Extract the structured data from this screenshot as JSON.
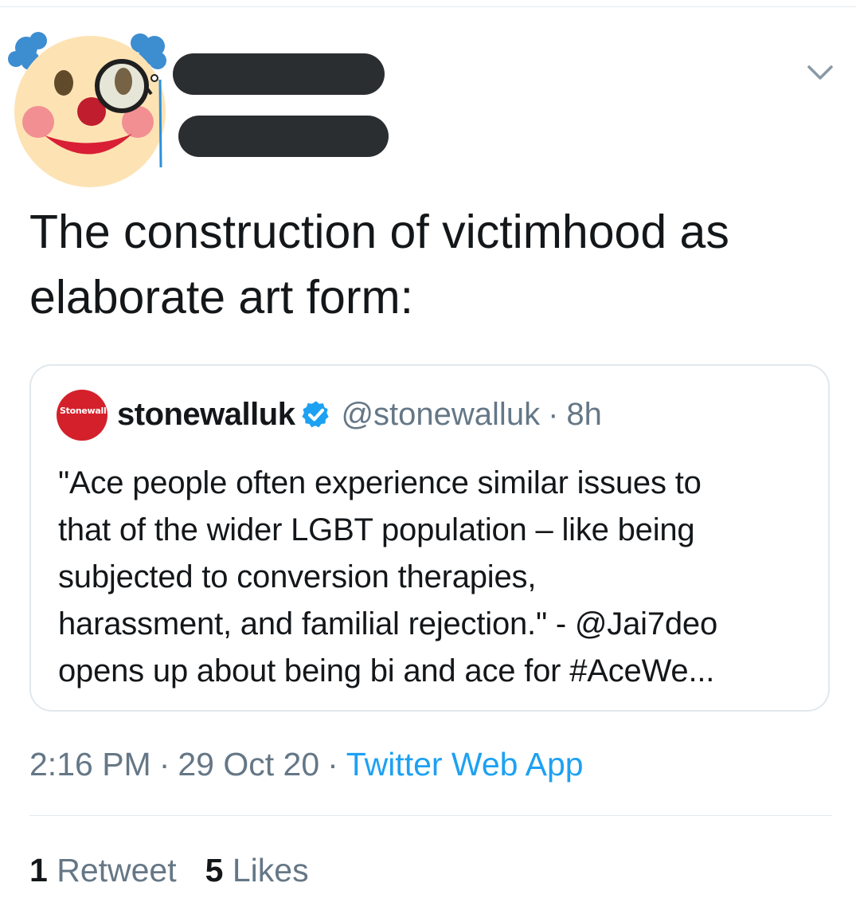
{
  "tweet": {
    "text": "The construction of victimhood as\nelaborate art form:",
    "caret_icon": "chevron-down-icon",
    "avatar_icon": "clown-monocle-avatar",
    "time": "2:16 PM",
    "date": "29 Oct 20",
    "separator": "·",
    "source": "Twitter Web App",
    "retweets_count": "1",
    "retweets_label": "Retweet",
    "likes_count": "5",
    "likes_label": "Likes"
  },
  "quoted": {
    "avatar_text": "Stonewall",
    "display_name": "stonewalluk",
    "verified_icon": "verified-badge-icon",
    "handle": "@stonewalluk",
    "separator": "·",
    "time": "8h",
    "text": "\"Ace people often experience similar issues to\nthat of the wider LGBT population – like being\nsubjected to conversion therapies,\nharassment, and familial rejection.\" - @Jai7deo\nopens up about being bi and ace for #AceWe..."
  },
  "colors": {
    "text": "#14171a",
    "secondary": "#657786",
    "link": "#1da1f2",
    "border": "#e1e8ed",
    "redaction": "#2b2e31",
    "stonewall_red": "#d4202b"
  }
}
